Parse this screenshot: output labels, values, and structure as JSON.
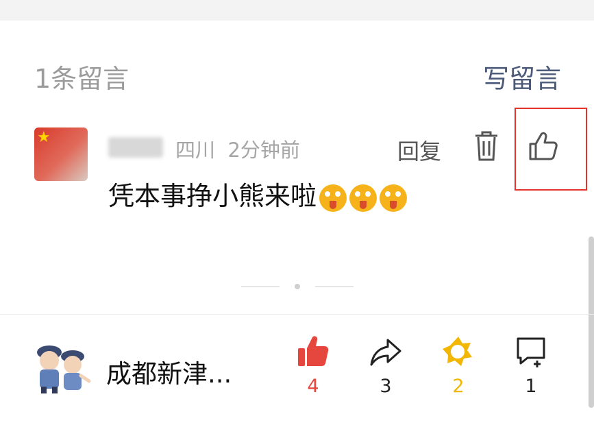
{
  "comments_header": {
    "count_label": "1条留言",
    "write_label": "写留言"
  },
  "comment": {
    "location": "四川",
    "time": "2分钟前",
    "reply_label": "回复",
    "text": "凭本事挣小熊来啦",
    "emoji_count": 3
  },
  "footer": {
    "source_name": "成都新津...",
    "actions": [
      {
        "name": "like",
        "count": "4",
        "color": "#e5463d"
      },
      {
        "name": "share",
        "count": "3",
        "color": "#222222"
      },
      {
        "name": "wow",
        "count": "2",
        "color": "#f2b705"
      },
      {
        "name": "comment",
        "count": "1",
        "color": "#222222"
      }
    ]
  },
  "icons": {
    "delete": "trash-icon",
    "like": "thumbs-up-icon",
    "share": "share-arrow-icon",
    "wow": "star-badge-icon",
    "comment": "comment-add-icon"
  }
}
